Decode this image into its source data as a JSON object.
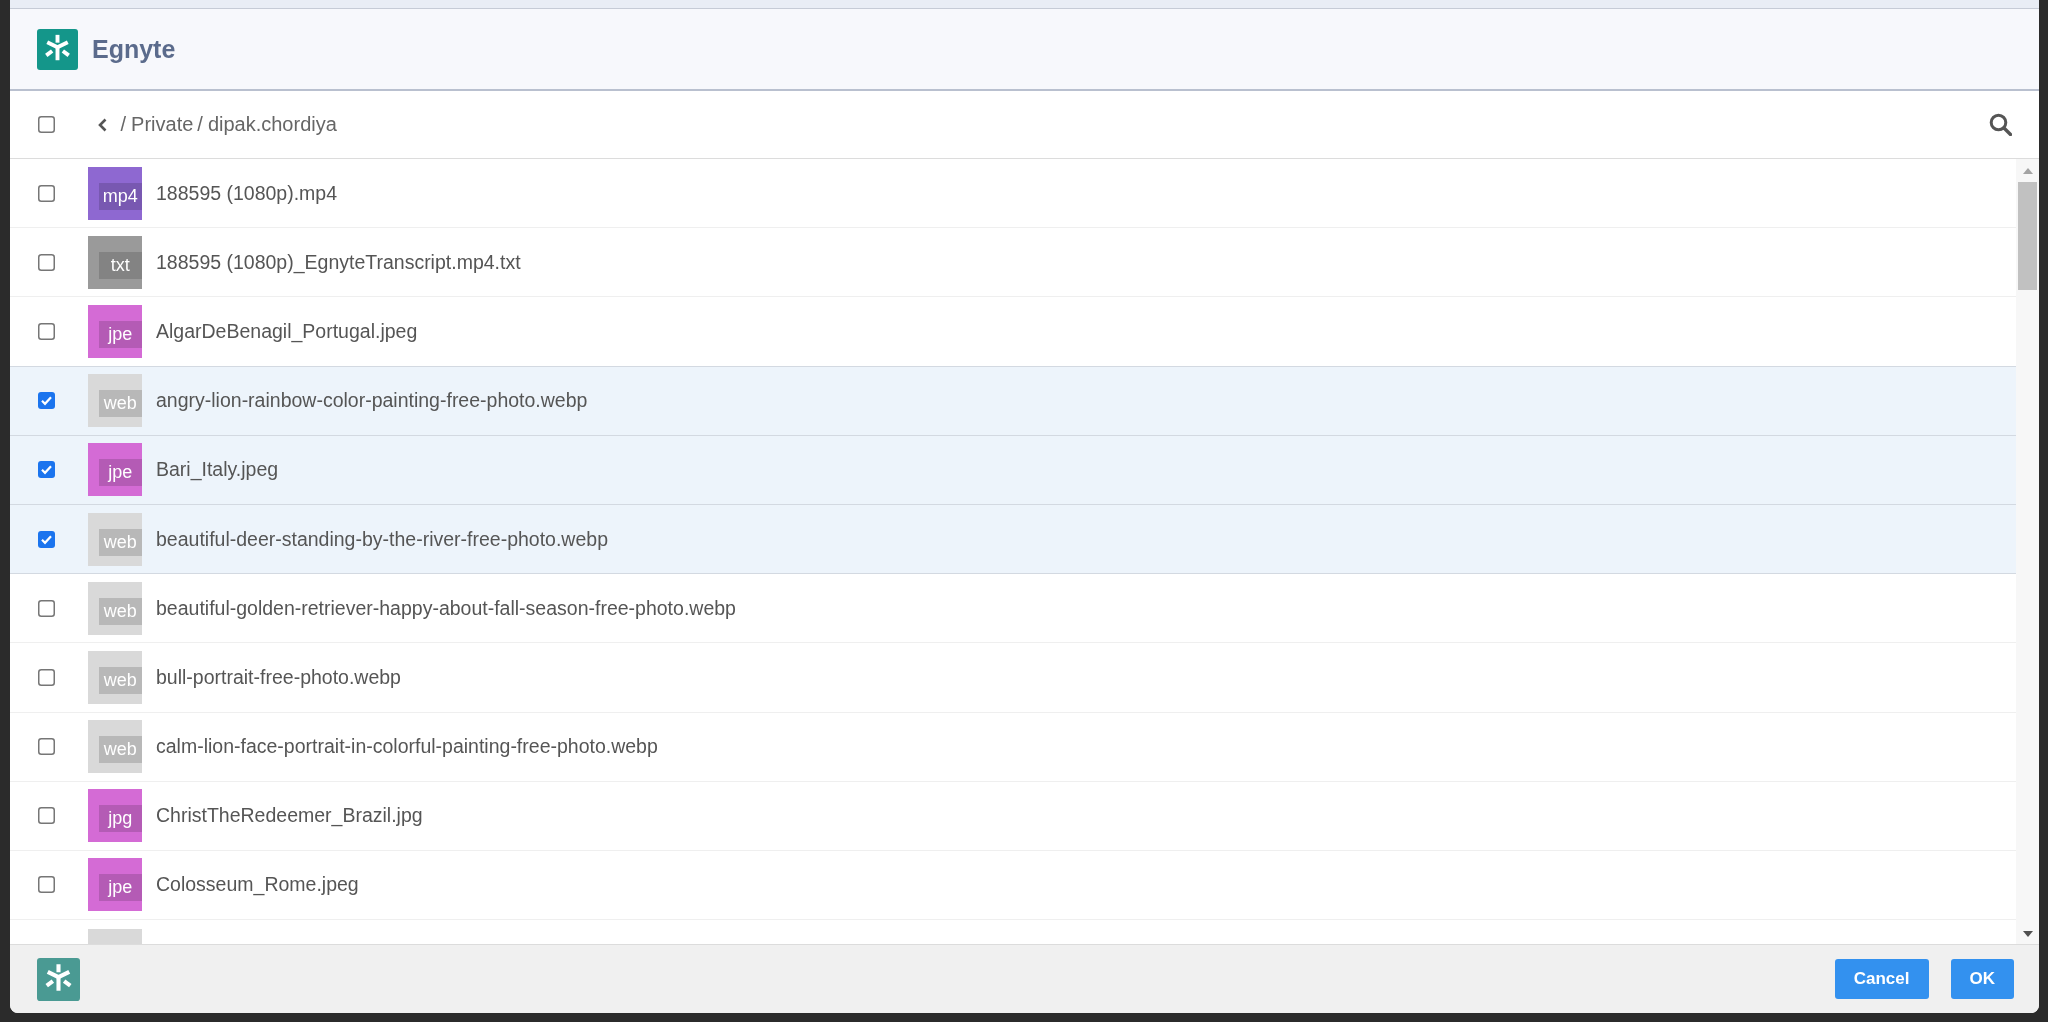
{
  "header": {
    "title": "Egnyte"
  },
  "toolbar": {
    "select_all": {
      "checked": false
    },
    "breadcrumb": [
      {
        "separator": "/",
        "label": "Private"
      },
      {
        "separator": "/",
        "label": "dipak.chordiya"
      }
    ]
  },
  "files": [
    {
      "kind": "file",
      "ext": "mp4",
      "color": "#8e68d1",
      "name": "188595 (1080p).mp4",
      "checked": false
    },
    {
      "kind": "file",
      "ext": "txt",
      "color": "#9a9a9a",
      "name": "188595 (1080p)_EgnyteTranscript.mp4.txt",
      "checked": false
    },
    {
      "kind": "file",
      "ext": "jpe",
      "color": "#d46bd5",
      "name": "AlgarDeBenagil_Portugal.jpeg",
      "checked": false
    },
    {
      "kind": "file",
      "ext": "web",
      "color": "#d9d9d9",
      "name": "angry-lion-rainbow-color-painting-free-photo.webp",
      "checked": true
    },
    {
      "kind": "file",
      "ext": "jpe",
      "color": "#d46bd5",
      "name": "Bari_Italy.jpeg",
      "checked": true
    },
    {
      "kind": "file",
      "ext": "web",
      "color": "#d9d9d9",
      "name": "beautiful-deer-standing-by-the-river-free-photo.webp",
      "checked": true
    },
    {
      "kind": "file",
      "ext": "web",
      "color": "#d9d9d9",
      "name": "beautiful-golden-retriever-happy-about-fall-season-free-photo.webp",
      "checked": false
    },
    {
      "kind": "file",
      "ext": "web",
      "color": "#d9d9d9",
      "name": "bull-portrait-free-photo.webp",
      "checked": false
    },
    {
      "kind": "file",
      "ext": "web",
      "color": "#d9d9d9",
      "name": "calm-lion-face-portrait-in-colorful-painting-free-photo.webp",
      "checked": false
    },
    {
      "kind": "file",
      "ext": "jpg",
      "color": "#d46bd5",
      "name": "ChristTheRedeemer_Brazil.jpg",
      "checked": false
    },
    {
      "kind": "file",
      "ext": "jpe",
      "color": "#d46bd5",
      "name": "Colosseum_Rome.jpeg",
      "checked": false
    },
    {
      "kind": "partial",
      "color": "#d9d9d9"
    }
  ],
  "footer": {
    "buttons": [
      {
        "label": "Cancel"
      },
      {
        "label": "OK"
      }
    ]
  }
}
